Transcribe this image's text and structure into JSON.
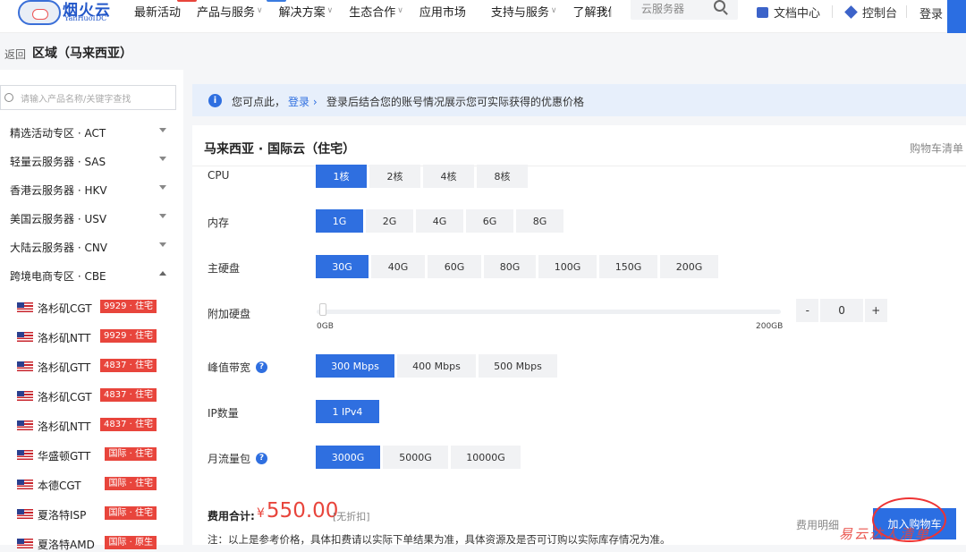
{
  "header": {
    "logo_name": "烟火云",
    "logo_sub": "YanHuoIDC",
    "nav": [
      "最新活动",
      "产品与服务",
      "解决方案",
      "生态合作",
      "应用市场",
      "支持与服务",
      "了解我们"
    ],
    "search_placeholder": "云服务器",
    "docs": "文档中心",
    "console": "控制台",
    "login": "登录"
  },
  "breadcrumb": {
    "back": "返回",
    "title": "区域（马来西亚）"
  },
  "sidebar": {
    "search_placeholder": "请输入产品名称/关键字查找",
    "categories": [
      "精选活动专区 · ACT",
      "轻量云服务器 · SAS",
      "香港云服务器 · HKV",
      "美国云服务器 · USV",
      "大陆云服务器 · CNV",
      "跨境电商专区 · CBE"
    ],
    "items": [
      {
        "name": "洛杉矶CGT",
        "tag": "9929 · 住宅"
      },
      {
        "name": "洛杉矶NTT",
        "tag": "9929 · 住宅"
      },
      {
        "name": "洛杉矶GTT",
        "tag": "4837 · 住宅"
      },
      {
        "name": "洛杉矶CGT",
        "tag": "4837 · 住宅"
      },
      {
        "name": "洛杉矶NTT",
        "tag": "4837 · 住宅"
      },
      {
        "name": "华盛顿GTT",
        "tag": "国际 · 住宅"
      },
      {
        "name": "本德CGT",
        "tag": "国际 · 住宅"
      },
      {
        "name": "夏洛特ISP",
        "tag": "国际 · 住宅"
      },
      {
        "name": "夏洛特AMD",
        "tag": "国际 · 原生"
      }
    ]
  },
  "notice": {
    "text1": "您可点此，",
    "link": "登录",
    "text2": "登录后结合您的账号情况展示您可实际获得的优惠价格"
  },
  "panel": {
    "title": "马来西亚 · 国际云（住宅）",
    "cart_list": "购物车清单",
    "cpu": {
      "label": "CPU",
      "options": [
        "1核",
        "2核",
        "4核",
        "8核"
      ]
    },
    "memory": {
      "label": "内存",
      "options": [
        "1G",
        "2G",
        "4G",
        "6G",
        "8G"
      ]
    },
    "disk": {
      "label": "主硬盘",
      "options": [
        "30G",
        "40G",
        "60G",
        "80G",
        "100G",
        "150G",
        "200G"
      ]
    },
    "extra_disk": {
      "label": "附加硬盘",
      "min": "0GB",
      "max": "200GB",
      "value": "0",
      "minus": "-",
      "plus": "+"
    },
    "bandwidth": {
      "label": "峰值带宽",
      "options": [
        "300 Mbps",
        "400 Mbps",
        "500 Mbps"
      ]
    },
    "ip": {
      "label": "IP数量",
      "options": [
        "1 IPv4"
      ]
    },
    "traffic": {
      "label": "月流量包",
      "options": [
        "3000G",
        "5000G",
        "10000G"
      ]
    },
    "total_label": "费用合计:",
    "currency": "¥",
    "price": "550.00",
    "no_discount": "[无折扣]",
    "detail": "费用明细",
    "add_cart": "加入购物车",
    "watermark": "易云达人清单",
    "note": "注：以上是参考价格，具体扣费请以实际下单结果为准，具体资源及是否可订购以实际库存情况为准。"
  }
}
